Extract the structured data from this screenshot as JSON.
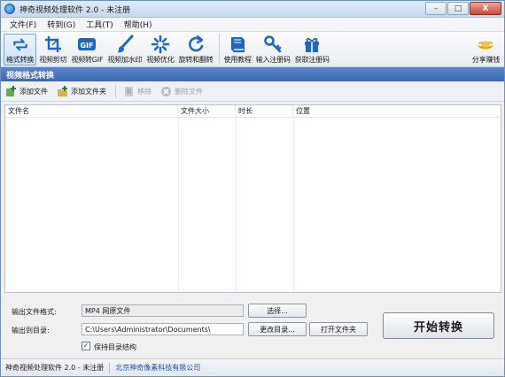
{
  "window": {
    "title": "神奇视频处理软件 2.0 - 未注册",
    "buttons": {
      "min": "–",
      "max": "□",
      "close": "X"
    }
  },
  "menu": [
    "文件(F)",
    "转到(G)",
    "工具(T)",
    "帮助(H)"
  ],
  "toolbar": {
    "tools": [
      {
        "label": "格式转换",
        "icon": "format-convert-icon"
      },
      {
        "label": "视频剪切",
        "icon": "crop-icon"
      },
      {
        "label": "视频转GIF",
        "icon": "gif-icon"
      },
      {
        "label": "视频加水印",
        "icon": "brush-icon"
      },
      {
        "label": "视频优化",
        "icon": "sparkle-icon"
      },
      {
        "label": "旋转和翻转",
        "icon": "rotate-icon"
      },
      {
        "label": "使用教程",
        "icon": "book-icon"
      },
      {
        "label": "输入注册码",
        "icon": "key-icon"
      },
      {
        "label": "获取注册码",
        "icon": "gift-icon"
      }
    ],
    "share": {
      "label": "分享赚钱",
      "icon": "gold-ingot-icon"
    }
  },
  "section_title": "视频格式转换",
  "actions": {
    "add_file": "添加文件",
    "add_folder": "添加文件夹",
    "remove": "移除",
    "delete_file": "删除文件"
  },
  "table": {
    "columns": [
      "文件名",
      "文件大小",
      "时长",
      "位置"
    ],
    "rows": []
  },
  "output": {
    "format_label": "输出文件格式:",
    "format_value": "MP4 网原文件",
    "select_button": "选择...",
    "dir_label": "输出到目录:",
    "dir_value": "C:\\Users\\Administrator\\Documents\\",
    "change_dir_button": "更改目录...",
    "open_folder_button": "打开文件夹",
    "keep_structure_label": "保持目录结构",
    "keep_structure_checked": true,
    "start_button": "开始转换"
  },
  "status": {
    "app": "神奇视频处理软件 2.0 - 未注册",
    "company": "北京神奇像素科技有限公司"
  }
}
